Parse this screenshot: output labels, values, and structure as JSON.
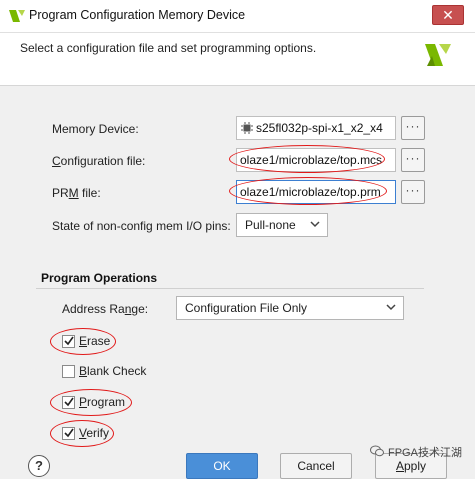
{
  "window": {
    "title": "Program Configuration Memory Device",
    "close_glyph": "✕"
  },
  "header": {
    "description": "Select a configuration file and set programming options."
  },
  "form": {
    "memory_device_label": "Memory Device:",
    "memory_device_value": "s25fl032p-spi-x1_x2_x4",
    "config_file_label_u": "C",
    "config_file_label_rest": "onfiguration file:",
    "config_file_value": "olaze1/microblaze/top.mcs",
    "prm_file_label_pre": "PR",
    "prm_file_label_u": "M",
    "prm_file_label_rest": " file:",
    "prm_file_value": "olaze1/microblaze/top.prm",
    "state_label": "State of non-config mem I/O pins:",
    "state_value": "Pull-none",
    "browse_glyph": "···"
  },
  "program_operations": {
    "section_title": "Program Operations",
    "address_range_label_pre": "Address Ra",
    "address_range_label_u": "n",
    "address_range_label_rest": "ge:",
    "address_range_value": "Configuration File Only",
    "options": [
      {
        "label_u": "E",
        "label_rest": "rase",
        "checked": true
      },
      {
        "label_u": "B",
        "label_rest": "lank Check",
        "checked": false
      },
      {
        "label_u": "P",
        "label_rest": "rogram",
        "checked": true
      },
      {
        "label_u": "V",
        "label_rest": "erify",
        "checked": true
      }
    ]
  },
  "footer": {
    "help_glyph": "?",
    "ok_label": "OK",
    "cancel_label": "Cancel",
    "apply_label_u": "A",
    "apply_label_rest": "pply",
    "watermark": "FPGA技术江湖"
  },
  "colors": {
    "accent_blue": "#4a8fd8",
    "annotation_red": "#e11a1a",
    "xilinx_green": "#7ab800"
  }
}
